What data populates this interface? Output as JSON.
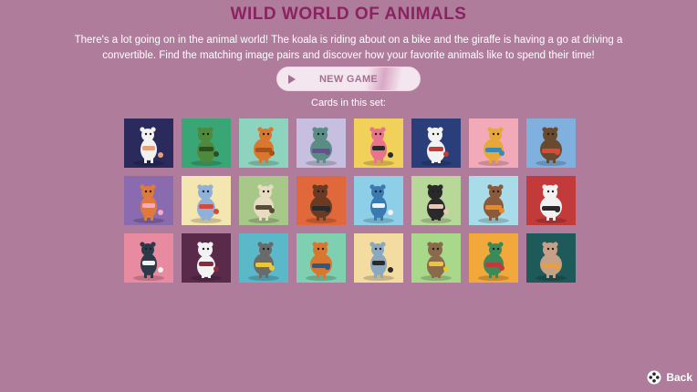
{
  "title": "WILD WORLD OF ANIMALS",
  "intro": "There's a lot going on in the animal world! The koala is riding about on a bike and the giraffe is having a go at driving a convertible. Find the matching image pairs and discover how your favorite animals like to spend their time!",
  "new_game": {
    "label": "NEW GAME",
    "icon": "play-icon"
  },
  "cards_label": "Cards in this set:",
  "cards": [
    {
      "animal": "astronaut girl",
      "bg": "#2a2a5c",
      "body": "#f2f2f2",
      "accent": "#e8a07a"
    },
    {
      "animal": "frog with laptop",
      "bg": "#3aa676",
      "body": "#4f8a3c",
      "accent": "#2d4c2a"
    },
    {
      "animal": "cat with coffee",
      "bg": "#8ed3be",
      "body": "#d9772e",
      "accent": "#a84f1a"
    },
    {
      "animal": "fish on rug",
      "bg": "#c7bfe0",
      "body": "#5a8d85",
      "accent": "#6b4d90"
    },
    {
      "animal": "flamingo",
      "bg": "#f2d15a",
      "body": "#e8738b",
      "accent": "#2a2a2a"
    },
    {
      "animal": "dog with hula hoop",
      "bg": "#2a3f7a",
      "body": "#f2f2f2",
      "accent": "#c23a3a"
    },
    {
      "animal": "giraffe in car",
      "bg": "#f2aab8",
      "body": "#e8a838",
      "accent": "#3a8ab8"
    },
    {
      "animal": "hedgehog",
      "bg": "#7fb0de",
      "body": "#6a4a2e",
      "accent": "#d84a3a"
    },
    {
      "animal": "fox ballerina",
      "bg": "#8a6bb0",
      "body": "#e07a3a",
      "accent": "#f5a8c8"
    },
    {
      "animal": "koala on bike",
      "bg": "#f4e6b0",
      "body": "#8fb0d8",
      "accent": "#d24a3a"
    },
    {
      "animal": "llama",
      "bg": "#a8c88a",
      "body": "#e8dcc0",
      "accent": "#5a4a3a"
    },
    {
      "animal": "horse with guitar",
      "bg": "#e0683a",
      "body": "#6a3a22",
      "accent": "#2a2a2a"
    },
    {
      "animal": "shark in bathtub",
      "bg": "#8ecfe8",
      "body": "#3a7ab0",
      "accent": "#f2f2f2"
    },
    {
      "animal": "ostrich skating",
      "bg": "#b8d89a",
      "body": "#2a2a2a",
      "accent": "#e8c8b8"
    },
    {
      "animal": "owl with umbrella",
      "bg": "#a8dce8",
      "body": "#8a5a3a",
      "accent": "#e88a2a"
    },
    {
      "animal": "panda eating",
      "bg": "#c23a3a",
      "body": "#f2f2f2",
      "accent": "#2a2a2a"
    },
    {
      "animal": "penguin with phone",
      "bg": "#e88aa0",
      "body": "#2a3a4a",
      "accent": "#f2f2f2"
    },
    {
      "animal": "polar bear",
      "bg": "#5a2a4a",
      "body": "#f2f2f2",
      "accent": "#8a2a3a"
    },
    {
      "animal": "raccoon",
      "bg": "#5ab8c8",
      "body": "#6a6a6a",
      "accent": "#e8c83a"
    },
    {
      "animal": "seahorse",
      "bg": "#7fd0b0",
      "body": "#d9772e",
      "accent": "#2a5a8a"
    },
    {
      "animal": "shark",
      "bg": "#f4dca0",
      "body": "#8aa8c0",
      "accent": "#2a2a2a"
    },
    {
      "animal": "sloth",
      "bg": "#a8d88a",
      "body": "#8a6a4a",
      "accent": "#e8c83a"
    },
    {
      "animal": "turtle knitting",
      "bg": "#f2a83a",
      "body": "#3a8a5a",
      "accent": "#c23a3a"
    },
    {
      "animal": "rabbit on board",
      "bg": "#1e5a5a",
      "body": "#c8a088",
      "accent": "#e8a03a"
    }
  ],
  "back": {
    "label": "Back",
    "icon": "gamepad-icon"
  },
  "colors": {
    "background": "#b07c9c",
    "title": "#8a2361",
    "button_text": "#a56f91"
  }
}
